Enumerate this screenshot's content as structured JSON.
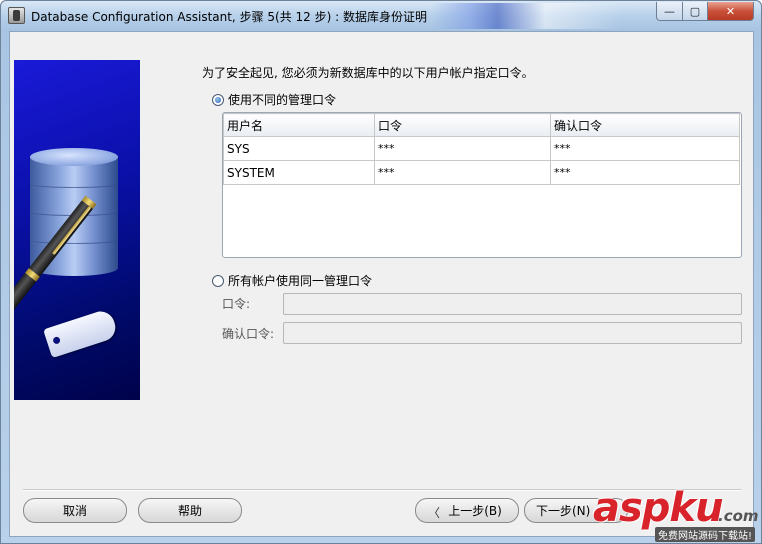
{
  "window": {
    "title": "Database Configuration Assistant, 步骤 5(共 12 步) : 数据库身份证明",
    "min_symbol": "—",
    "max_symbol": "▢",
    "close_symbol": "✕"
  },
  "content": {
    "instruction": "为了安全起见, 您必须为新数据库中的以下用户帐户指定口令。",
    "option_different": "使用不同的管理口令",
    "option_same": "所有帐户使用同一管理口令",
    "selected_option": "different"
  },
  "grid": {
    "headers": [
      "用户名",
      "口令",
      "确认口令"
    ],
    "rows": [
      {
        "user": "SYS",
        "password": "***",
        "confirm": "***"
      },
      {
        "user": "SYSTEM",
        "password": "***",
        "confirm": "***"
      }
    ]
  },
  "same_password": {
    "password_label": "口令:",
    "confirm_label": "确认口令:",
    "password_value": "",
    "confirm_value": ""
  },
  "buttons": {
    "cancel": "取消",
    "help": "帮助",
    "back": "上一步(B)",
    "next": "下一步(N)",
    "back_arrow": "〈"
  },
  "watermark": {
    "brand": "aspku",
    "suffix": ".com",
    "tagline": "免费网站源码下载站!"
  },
  "colors": {
    "banner": "#0a10a8",
    "watermark_red": "#d8232a",
    "radio_selected": "#1f5fb5"
  }
}
